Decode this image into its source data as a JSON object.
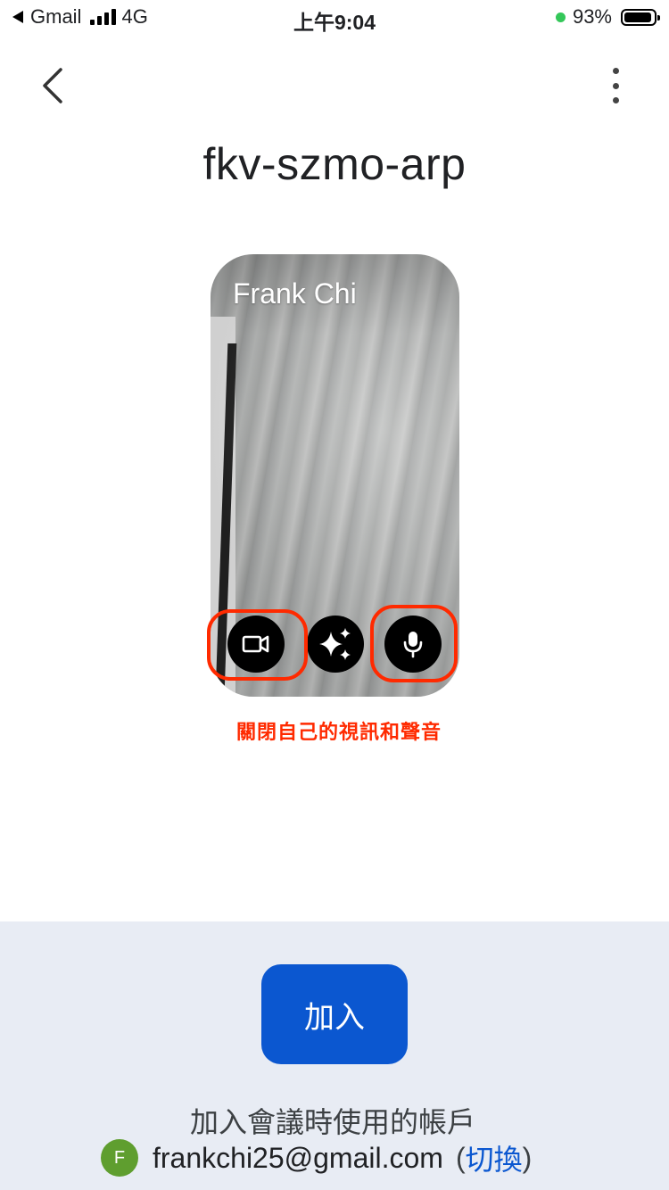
{
  "status_bar": {
    "back_app": "Gmail",
    "network": "4G",
    "time": "上午9:04",
    "battery": "93%",
    "battery_level": 0.93
  },
  "header": {
    "meeting_code": "fkv-szmo-arp",
    "back_icon": "chevron-left-icon",
    "more_icon": "more-vert-icon"
  },
  "preview": {
    "participant_name": "Frank Chi",
    "controls": {
      "camera_icon": "videocam-icon",
      "effects_icon": "sparkle-icon",
      "mic_icon": "mic-icon"
    },
    "annotation": "關閉自己的視訊和聲音",
    "highlight_color": "#ff2a00"
  },
  "join": {
    "button_label": "加入",
    "button_color": "#0b57d0"
  },
  "account": {
    "label": "加入會議時使用的帳戶",
    "avatar_letter": "F",
    "email": "frankchi25@gmail.com",
    "paren_open": "(",
    "switch_label": "切換",
    "paren_close": ")"
  }
}
